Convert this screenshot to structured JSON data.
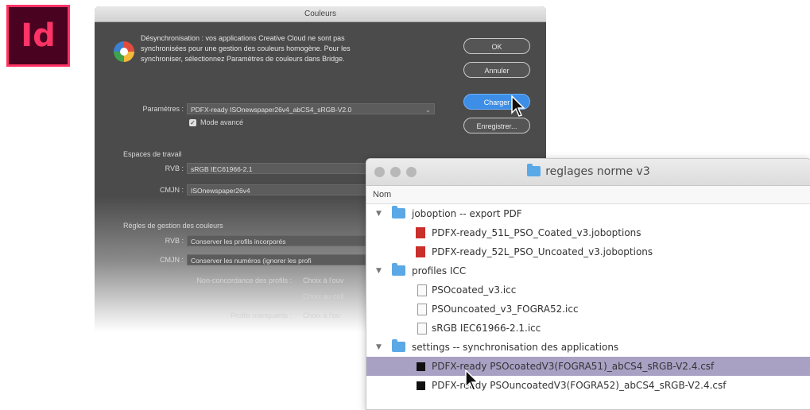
{
  "app_logo": {
    "text": "Id"
  },
  "color_dialog": {
    "title": "Couleurs",
    "sync_message": "Désynchronisation : vos applications Creative Cloud ne sont pas\nsynchronisées pour une gestion des couleurs homogène. Pour les\nsynchroniser, sélectionnez Paramètres de couleurs dans Bridge.",
    "buttons": {
      "ok": "OK",
      "cancel": "Annuler",
      "load": "Charger",
      "save": "Enregistrer..."
    },
    "settings_label": "Paramètres :",
    "settings_value": "PDFX-ready ISOnewspaper26v4_abCS4_sRGB-V2.0",
    "advanced_mode_label": "Mode avancé",
    "working_spaces_title": "Espaces de travail",
    "rgb_label": "RVB :",
    "rgb_value": "sRGB IEC61966-2.1",
    "cmyk_label": "CMJN :",
    "cmyk_value": "ISOnewspaper26v4",
    "policies_title": "Règles de gestion des couleurs",
    "policy_rgb_label": "RVB :",
    "policy_rgb_value": "Conserver les profils incorporés",
    "policy_cmyk_label": "CMJN :",
    "policy_cmyk_value": "Conserver les numéros (ignorer les profi",
    "mismatch_label": "Non-concordance des profils :",
    "mismatch_open": "Choix à l'ouv",
    "mismatch_paste": "Choix au coll",
    "missing_label": "Profils manquants :",
    "missing_open": "Choix à l'ou"
  },
  "finder": {
    "title": "reglages norme v3",
    "column_header": "Nom",
    "rows": [
      {
        "label": "joboption -- export PDF",
        "type": "folder"
      },
      {
        "label": "PDFX-ready_51L_PSO_Coated_v3.joboptions",
        "type": "pdf"
      },
      {
        "label": "PDFX-ready_52L_PSO_Uncoated_v3.joboptions",
        "type": "pdf"
      },
      {
        "label": "profiles ICC",
        "type": "folder"
      },
      {
        "label": "PSOcoated_v3.icc",
        "type": "doc"
      },
      {
        "label": "PSOuncoated_v3_FOGRA52.icc",
        "type": "doc"
      },
      {
        "label": "sRGB IEC61966-2.1.icc",
        "type": "doc"
      },
      {
        "label": "settings -- synchronisation des applications",
        "type": "folder"
      },
      {
        "label": "PDFX-ready PSOcoatedV3(FOGRA51)_abCS4_sRGB-V2.4.csf",
        "type": "csf",
        "selected": true
      },
      {
        "label": "PDFX-ready PSOuncoatedV3(FOGRA52)_abCS4_sRGB-V2.4.csf",
        "type": "csf"
      }
    ]
  },
  "colors": {
    "accent_blue": "#3d8ee6",
    "selection": "#a9a1c4",
    "indesign_pink": "#ff3366",
    "indesign_bg": "#49021f"
  }
}
